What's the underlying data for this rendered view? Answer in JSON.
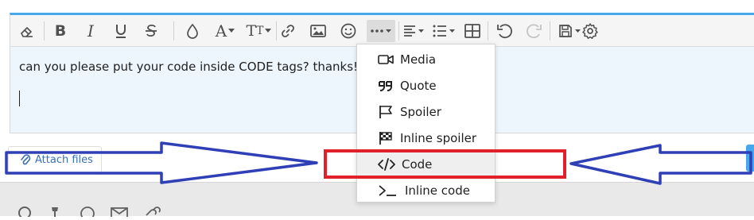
{
  "editor": {
    "message_text": "can you please put your code inside CODE tags?  thanks!",
    "toolbar": {
      "buttons": [
        "eraser-icon",
        "bold-icon",
        "italic-icon",
        "underline-icon",
        "strikethrough-icon",
        "text-color-icon",
        "font-family-icon",
        "font-size-icon",
        "link-icon",
        "image-icon",
        "smilie-icon",
        "more-options-icon",
        "align-icon",
        "list-icon",
        "table-icon",
        "undo-icon",
        "redo-icon",
        "drafts-icon",
        "settings-icon"
      ]
    }
  },
  "insert_menu": {
    "items": [
      {
        "label": "Media",
        "icon": "video-icon"
      },
      {
        "label": "Quote",
        "icon": "quote-icon"
      },
      {
        "label": "Spoiler",
        "icon": "flag-icon"
      },
      {
        "label": "Inline spoiler",
        "icon": "checkered-flag-icon"
      },
      {
        "label": "Code",
        "icon": "code-icon"
      },
      {
        "label": "Inline code",
        "icon": "terminal-icon"
      }
    ]
  },
  "attach": {
    "label": "Attach files"
  },
  "annotations": {
    "highlight_color": "#e0202a",
    "arrow_color": "#2f3fb6"
  }
}
